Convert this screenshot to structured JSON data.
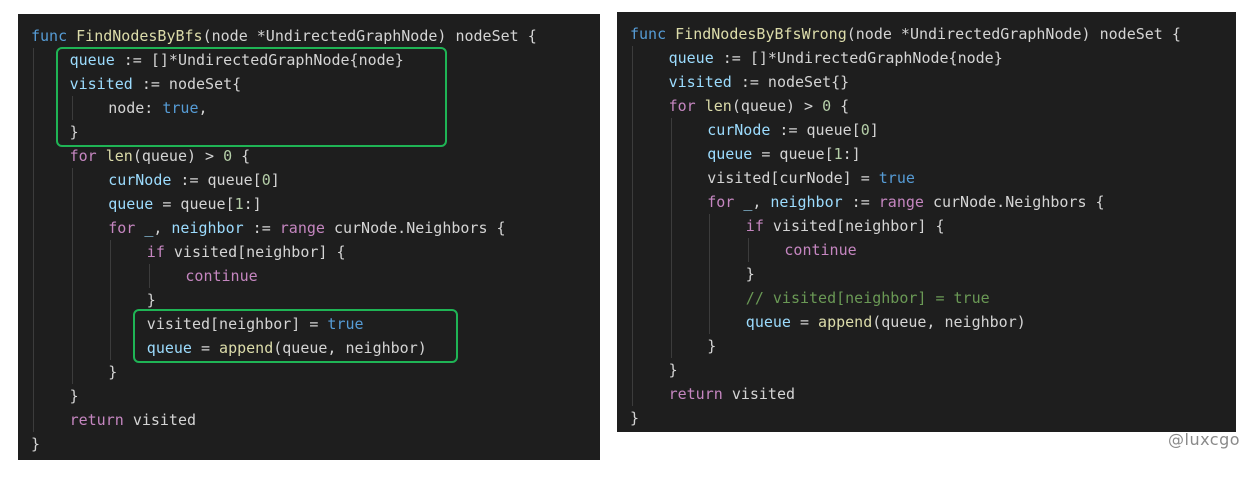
{
  "left_panel": {
    "lines": [
      [
        [
          "kw",
          "func "
        ],
        [
          "fn",
          "FindNodesByBfs"
        ],
        [
          "p",
          "(node *UndirectedGraphNode) nodeSet {"
        ]
      ],
      [
        [
          "var",
          "queue"
        ],
        [
          "p",
          " := []*UndirectedGraphNode{node}"
        ]
      ],
      [
        [
          "var",
          "visited"
        ],
        [
          "p",
          " := nodeSet{"
        ]
      ],
      [
        [
          "p",
          "node: "
        ],
        [
          "kw",
          "true"
        ],
        [
          "p",
          ","
        ]
      ],
      [
        [
          "p",
          "}"
        ]
      ],
      [
        [
          "ctl",
          "for "
        ],
        [
          "fn",
          "len"
        ],
        [
          "p",
          "(queue) > "
        ],
        [
          "num",
          "0"
        ],
        [
          "p",
          " {"
        ]
      ],
      [
        [
          "var",
          "curNode"
        ],
        [
          "p",
          " := queue["
        ],
        [
          "num",
          "0"
        ],
        [
          "p",
          "]"
        ]
      ],
      [
        [
          "var",
          "queue"
        ],
        [
          "p",
          " = queue["
        ],
        [
          "num",
          "1"
        ],
        [
          "p",
          ":]"
        ]
      ],
      [
        [
          "ctl",
          "for "
        ],
        [
          "var",
          "_"
        ],
        [
          "p",
          ", "
        ],
        [
          "var",
          "neighbor"
        ],
        [
          "p",
          " := "
        ],
        [
          "ctl",
          "range"
        ],
        [
          "p",
          " curNode.Neighbors {"
        ]
      ],
      [
        [
          "ctl",
          "if "
        ],
        [
          "p",
          "visited[neighbor] {"
        ]
      ],
      [
        [
          "ctl",
          "continue"
        ]
      ],
      [
        [
          "p",
          "}"
        ]
      ],
      [
        [
          "p",
          "visited[neighbor] = "
        ],
        [
          "kw",
          "true"
        ]
      ],
      [
        [
          "var",
          "queue"
        ],
        [
          "p",
          " = "
        ],
        [
          "fn",
          "append"
        ],
        [
          "p",
          "(queue, neighbor)"
        ]
      ],
      [
        [
          "p",
          "}"
        ]
      ],
      [
        [
          "p",
          "}"
        ]
      ],
      [
        [
          "ctl",
          "return "
        ],
        [
          "p",
          "visited"
        ]
      ],
      [
        [
          "p",
          "}"
        ]
      ]
    ]
  },
  "right_panel": {
    "lines": [
      [
        [
          "kw",
          "func "
        ],
        [
          "fn",
          "FindNodesByBfsWrong"
        ],
        [
          "p",
          "(node *UndirectedGraphNode) nodeSet {"
        ]
      ],
      [
        [
          "var",
          "queue"
        ],
        [
          "p",
          " := []*UndirectedGraphNode{node}"
        ]
      ],
      [
        [
          "var",
          "visited"
        ],
        [
          "p",
          " := nodeSet{}"
        ]
      ],
      [
        [
          "ctl",
          "for "
        ],
        [
          "fn",
          "len"
        ],
        [
          "p",
          "(queue) > "
        ],
        [
          "num",
          "0"
        ],
        [
          "p",
          " {"
        ]
      ],
      [
        [
          "var",
          "curNode"
        ],
        [
          "p",
          " := queue["
        ],
        [
          "num",
          "0"
        ],
        [
          "p",
          "]"
        ]
      ],
      [
        [
          "var",
          "queue"
        ],
        [
          "p",
          " = queue["
        ],
        [
          "num",
          "1"
        ],
        [
          "p",
          ":]"
        ]
      ],
      [
        [
          "p",
          "visited[curNode] = "
        ],
        [
          "kw",
          "true"
        ]
      ],
      [
        [
          "ctl",
          "for "
        ],
        [
          "var",
          "_"
        ],
        [
          "p",
          ", "
        ],
        [
          "var",
          "neighbor"
        ],
        [
          "p",
          " := "
        ],
        [
          "ctl",
          "range"
        ],
        [
          "p",
          " curNode.Neighbors {"
        ]
      ],
      [
        [
          "ctl",
          "if "
        ],
        [
          "p",
          "visited[neighbor] {"
        ]
      ],
      [
        [
          "ctl",
          "continue"
        ]
      ],
      [
        [
          "p",
          "}"
        ]
      ],
      [
        [
          "cmt",
          "// visited[neighbor] = true"
        ]
      ],
      [
        [
          "var",
          "queue"
        ],
        [
          "p",
          " = "
        ],
        [
          "fn",
          "append"
        ],
        [
          "p",
          "(queue, neighbor)"
        ]
      ],
      [
        [
          "p",
          "}"
        ]
      ],
      [
        [
          "p",
          "}"
        ]
      ],
      [
        [
          "ctl",
          "return "
        ],
        [
          "p",
          "visited"
        ]
      ],
      [
        [
          "p",
          "}"
        ]
      ]
    ]
  },
  "watermark": "@luxcgo",
  "colors": {
    "background": "#1e1e1e",
    "keyword": "#569cd6",
    "control": "#c586c0",
    "function": "#dcdcaa",
    "variable": "#9cdcfe",
    "number": "#b5cea8",
    "comment": "#6a9955",
    "text": "#d4d4d4",
    "highlight_box": "#1fb455"
  }
}
